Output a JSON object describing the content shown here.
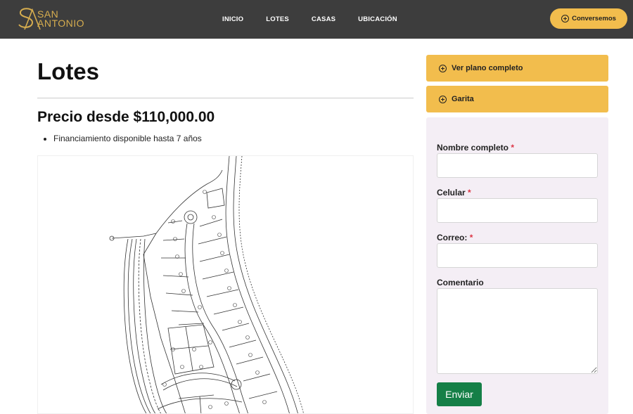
{
  "brand": {
    "line1": "SAN",
    "line2": "ANTONIO",
    "color": "#d6ad4f"
  },
  "nav": {
    "items": [
      "INICIO",
      "LOTES",
      "CASAS",
      "UBICACIÓN"
    ],
    "cta_label": "Conversemos",
    "cta_icon": "plus-circle-icon",
    "bg_color": "#3d3d3d",
    "accent_color": "#f2bd4d"
  },
  "main": {
    "title": "Lotes",
    "price": "Precio desde $110,000.00",
    "bullets": [
      "Financiamiento disponible hasta 7 años"
    ],
    "plan_image": "site-plan-lot-map"
  },
  "sidebar": {
    "accordion": [
      {
        "label": "Ver plano completo",
        "icon": "plus-circle-icon"
      },
      {
        "label": "Garita",
        "icon": "plus-circle-icon"
      }
    ],
    "form": {
      "fields": [
        {
          "label": "Nombre completo",
          "required": "*",
          "value": ""
        },
        {
          "label": "Celular",
          "required": "*",
          "value": ""
        },
        {
          "label": "Correo:",
          "required": "*",
          "value": ""
        }
      ],
      "comment_label": "Comentario",
      "comment_value": "",
      "submit_label": "Enviar",
      "submit_color": "#157f47",
      "card_color": "#f4eef5"
    }
  }
}
